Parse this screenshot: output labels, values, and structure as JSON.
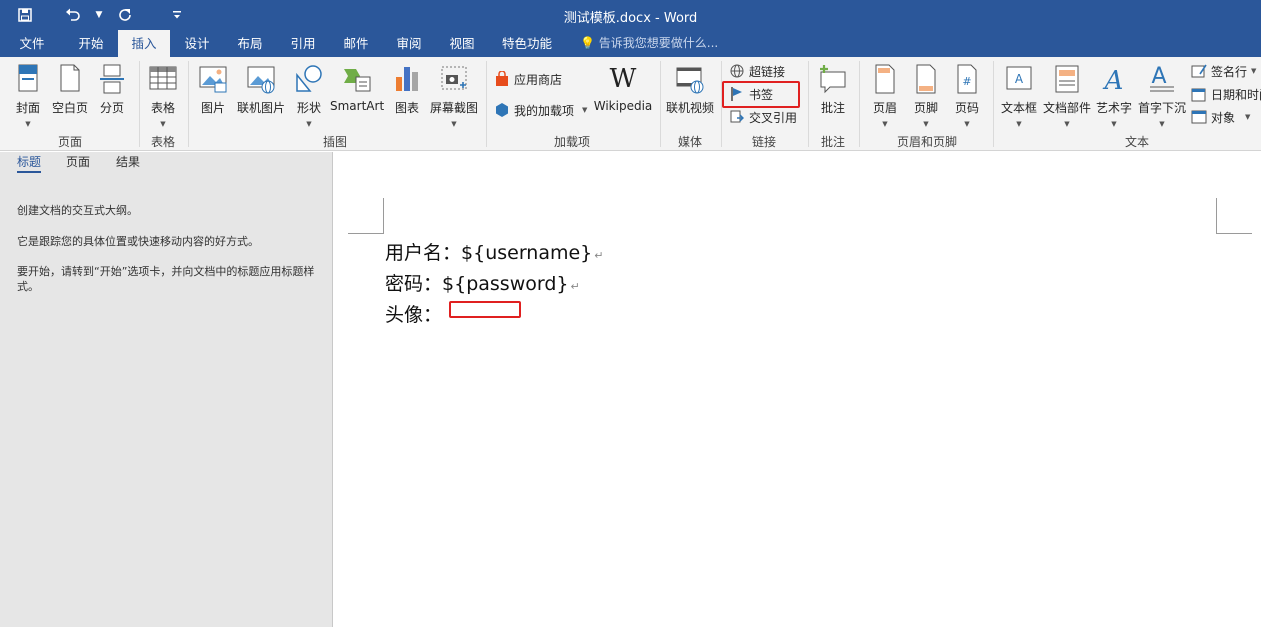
{
  "app": {
    "title": "测试模板.docx - Word"
  },
  "qat": {
    "save": "save",
    "undo": "undo",
    "redo": "redo",
    "customize": "customize"
  },
  "tabs": [
    {
      "label": "文件"
    },
    {
      "label": "开始"
    },
    {
      "label": "插入"
    },
    {
      "label": "设计"
    },
    {
      "label": "布局"
    },
    {
      "label": "引用"
    },
    {
      "label": "邮件"
    },
    {
      "label": "审阅"
    },
    {
      "label": "视图"
    },
    {
      "label": "特色功能"
    }
  ],
  "tell_me": {
    "placeholder": "告诉我您想要做什么..."
  },
  "ribbon": {
    "pages": {
      "label": "页面",
      "cover": "封面",
      "blank": "空白页",
      "break": "分页"
    },
    "table": {
      "label": "表格",
      "table": "表格"
    },
    "illustrations": {
      "label": "插图",
      "picture": "图片",
      "online_picture": "联机图片",
      "shapes": "形状",
      "smartart": "SmartArt",
      "chart": "图表",
      "screenshot": "屏幕截图"
    },
    "addins": {
      "label": "加载项",
      "store": "应用商店",
      "my_addins": "我的加载项",
      "wikipedia": "Wikipedia"
    },
    "media": {
      "label": "媒体",
      "online_video": "联机视频"
    },
    "links": {
      "label": "链接",
      "hyperlink": "超链接",
      "bookmark": "书签",
      "cross_ref": "交叉引用"
    },
    "comments": {
      "label": "批注",
      "comment": "批注"
    },
    "header_footer": {
      "label": "页眉和页脚",
      "header": "页眉",
      "footer": "页脚",
      "page_number": "页码"
    },
    "text": {
      "label": "文本",
      "textbox": "文本框",
      "quick_parts": "文档部件",
      "wordart": "艺术字",
      "dropcap": "首字下沉",
      "signature": "签名行",
      "datetime": "日期和时间",
      "object": "对象"
    }
  },
  "nav": {
    "tabs": [
      {
        "label": "标题"
      },
      {
        "label": "页面"
      },
      {
        "label": "结果"
      }
    ],
    "line1": "创建文档的交互式大纲。",
    "line2": "它是跟踪您的具体位置或快速移动内容的好方式。",
    "line3": "要开始，请转到“开始”选项卡，并向文档中的标题应用标题样式。"
  },
  "document": {
    "lines": [
      {
        "label": "用户名：",
        "value": "${username}"
      },
      {
        "label": "密码：",
        "value": "${password}"
      },
      {
        "label": "头像：",
        "value": ""
      }
    ],
    "para_mark": "↵"
  },
  "colors": {
    "accent": "#2b579a",
    "highlight": "#e02020"
  }
}
